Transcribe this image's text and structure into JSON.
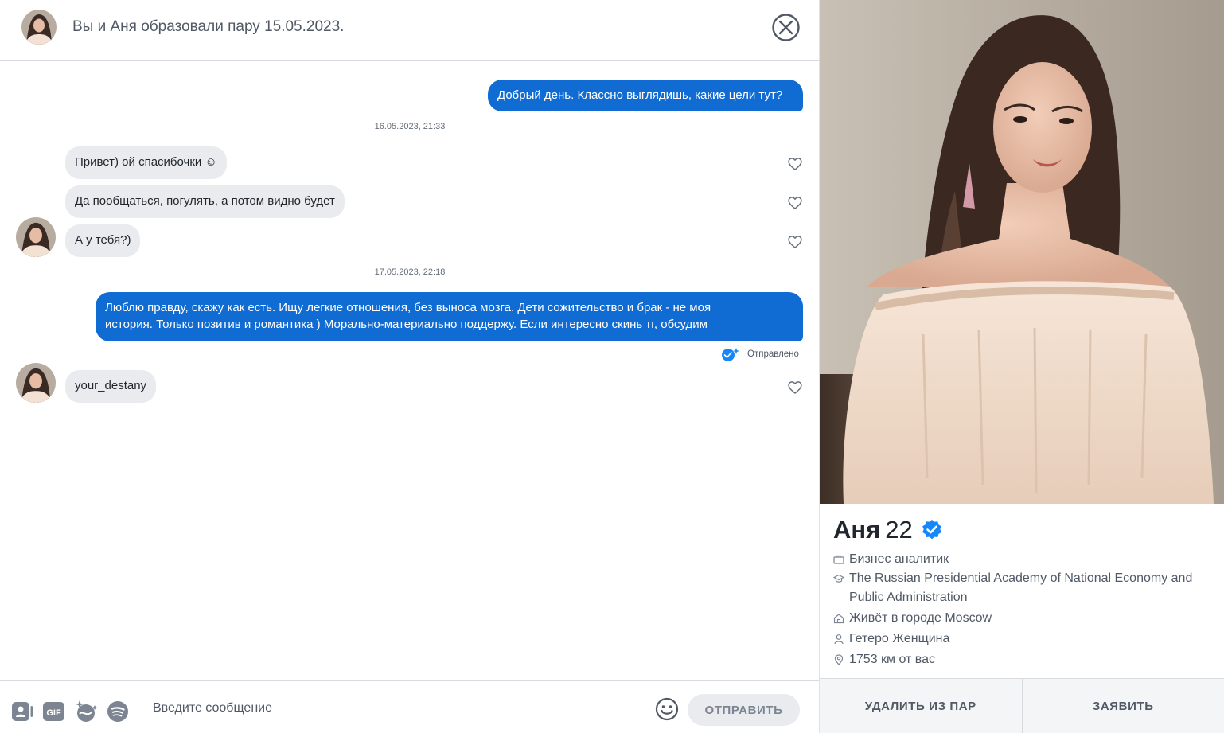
{
  "header": {
    "title": "Вы и Аня образовали пару 15.05.2023."
  },
  "messages": {
    "out1": "Добрый день. Классно выглядишь, какие цели тут?",
    "ts1": "16.05.2023, 21:33",
    "in1": "Привет) ой спасибочки ☺",
    "in2": "Да пообщаться, погулять, а потом видно будет",
    "in3": "А у тебя?)",
    "ts2": "17.05.2023, 22:18",
    "out2_line1": "Люблю правду, скажу как есть. Ищу легкие отношения, без выноса мозга. Дети сожительство и брак - не моя",
    "out2_line2": "история. Только позитив и романтика ) Морально-материально поддержу. Если интересно скинь тг, обсудим",
    "status": "Отправлено",
    "in4": "your_destany"
  },
  "composer": {
    "placeholder": "Введите сообщение",
    "gif_label": "GIF",
    "send_label": "ОТПРАВИТЬ"
  },
  "profile": {
    "name": "Аня",
    "age": "22",
    "job": "Бизнес аналитик",
    "school_line1": "The Russian Presidential Academy of National Economy and",
    "school_line2": "Public Administration",
    "city": "Живёт в городе Moscow",
    "orientation": "Гетеро Женщина",
    "distance": "1753 км от вас",
    "unmatch_label": "УДАЛИТЬ ИЗ ПАР",
    "report_label": "ЗАЯВИТЬ"
  },
  "colors": {
    "accent": "#106bd2",
    "bubble_in": "#e9ebee",
    "verified": "#1786f8"
  },
  "icons": [
    "close-icon",
    "heart-icon",
    "sent-check-icon",
    "sticker-icon",
    "gif-icon",
    "sparkle-icon",
    "spotify-icon",
    "emoji-icon",
    "verified-icon",
    "briefcase-icon",
    "graduation-cap-icon",
    "home-icon",
    "person-icon",
    "location-pin-icon"
  ]
}
